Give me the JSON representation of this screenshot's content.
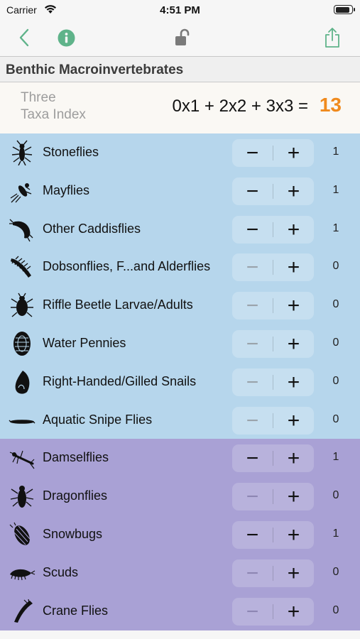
{
  "status_bar": {
    "carrier": "Carrier",
    "time": "4:51 PM"
  },
  "nav": {
    "back_icon": "chevron-left-icon",
    "info_icon": "info-icon",
    "lock_icon": "unlocked-padlock-icon",
    "share_icon": "share-icon",
    "accent_color": "#5fb38a"
  },
  "section": {
    "title": "Benthic Macroinvertebrates"
  },
  "index": {
    "label_line1": "Three",
    "label_line2": "Taxa Index",
    "formula": "0x1 + 2x2 + 3x3 =",
    "total": "13"
  },
  "colors": {
    "group1": "#b6d6ec",
    "group2": "#a9a1d5",
    "total": "#f08a1d"
  },
  "rows": [
    {
      "name": "Stoneflies",
      "count": "1",
      "group": 1,
      "minus": "−",
      "plus": "+"
    },
    {
      "name": "Mayflies",
      "count": "1",
      "group": 1,
      "minus": "−",
      "plus": "+"
    },
    {
      "name": "Other Caddisflies",
      "count": "1",
      "group": 1,
      "minus": "−",
      "plus": "+"
    },
    {
      "name": "Dobsonflies, F...and Alderflies",
      "count": "0",
      "group": 1,
      "minus": "−",
      "plus": "+"
    },
    {
      "name": "Riffle Beetle Larvae/Adults",
      "count": "0",
      "group": 1,
      "minus": "−",
      "plus": "+"
    },
    {
      "name": "Water Pennies",
      "count": "0",
      "group": 1,
      "minus": "−",
      "plus": "+"
    },
    {
      "name": "Right-Handed/Gilled Snails",
      "count": "0",
      "group": 1,
      "minus": "−",
      "plus": "+"
    },
    {
      "name": "Aquatic Snipe Flies",
      "count": "0",
      "group": 1,
      "minus": "−",
      "plus": "+"
    },
    {
      "name": "Damselflies",
      "count": "1",
      "group": 2,
      "minus": "−",
      "plus": "+"
    },
    {
      "name": "Dragonflies",
      "count": "0",
      "group": 2,
      "minus": "−",
      "plus": "+"
    },
    {
      "name": "Snowbugs",
      "count": "1",
      "group": 2,
      "minus": "−",
      "plus": "+"
    },
    {
      "name": "Scuds",
      "count": "0",
      "group": 2,
      "minus": "−",
      "plus": "+"
    },
    {
      "name": "Crane Flies",
      "count": "0",
      "group": 2,
      "minus": "−",
      "plus": "+"
    }
  ]
}
